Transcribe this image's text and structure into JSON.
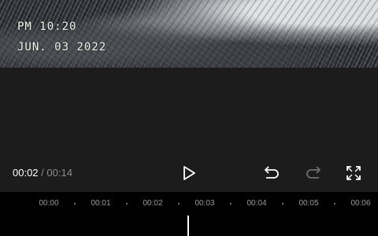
{
  "preview": {
    "time_stamp": "PM 10:20",
    "date_stamp": "JUN. 03 2022"
  },
  "playback": {
    "current_time": "00:02",
    "separator": " / ",
    "total_time": "00:14"
  },
  "icons": {
    "play": "play-icon",
    "undo": "undo-icon",
    "redo": "redo-icon",
    "fullscreen": "fullscreen-icon"
  },
  "timeline": {
    "ticks": [
      "00:00",
      "00:01",
      "00:02",
      "00:03",
      "00:04",
      "00:05",
      "00:06"
    ]
  }
}
